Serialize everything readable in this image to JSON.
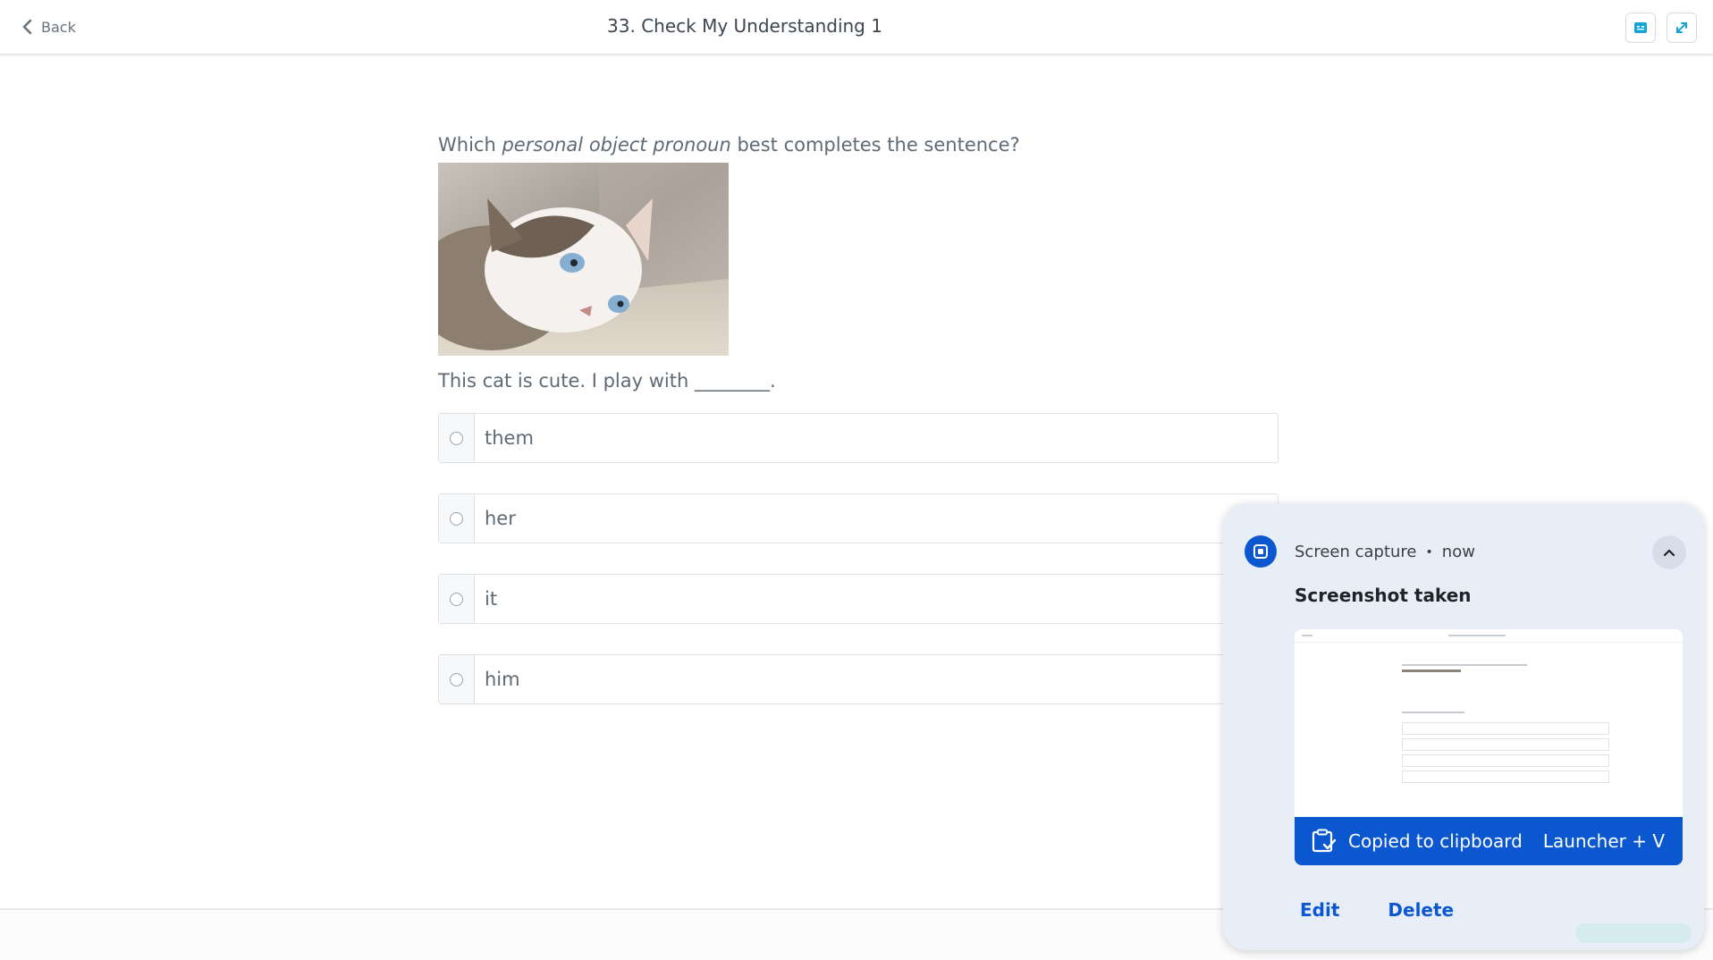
{
  "header": {
    "back_label": "Back",
    "title": "33. Check My Understanding 1",
    "icons": [
      "translate-icon",
      "expand-icon"
    ]
  },
  "question": {
    "prefix": "Which ",
    "emphasis": "personal object pronoun",
    "suffix": " best completes the sentence?",
    "sentence": "This cat is cute. I play with ________.",
    "options": [
      {
        "label": "them"
      },
      {
        "label": "her"
      },
      {
        "label": "it"
      },
      {
        "label": "him"
      }
    ]
  },
  "notification": {
    "app": "Screen capture",
    "time": "now",
    "title": "Screenshot taken",
    "clipboard_text": "Copied to clipboard",
    "shortcut": "Launcher + V",
    "actions": {
      "edit": "Edit",
      "delete": "Delete"
    },
    "accent": "#0b57d0"
  }
}
